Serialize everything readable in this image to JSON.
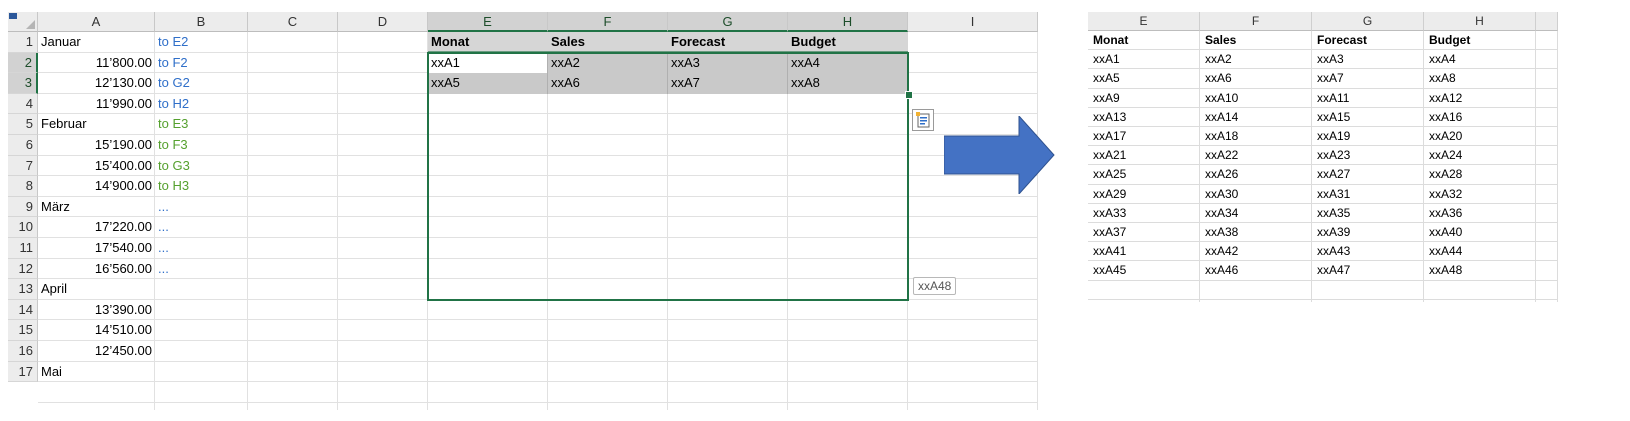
{
  "left_sheet": {
    "columns": [
      "A",
      "B",
      "C",
      "D",
      "E",
      "F",
      "G",
      "H",
      "I"
    ],
    "rows": [
      "1",
      "2",
      "3",
      "4",
      "5",
      "6",
      "7",
      "8",
      "9",
      "10",
      "11",
      "12",
      "13",
      "14",
      "15",
      "16",
      "17"
    ],
    "col_a": [
      "Januar",
      "11’800.00",
      "12’130.00",
      "11’990.00",
      "Februar",
      "15’190.00",
      "15’400.00",
      "14’900.00",
      "März",
      "17’220.00",
      "17’540.00",
      "16’560.00",
      "April",
      "13’390.00",
      "14’510.00",
      "12’450.00",
      "Mai"
    ],
    "col_b": [
      "to E2",
      "to F2",
      "to G2",
      "to H2",
      "to E3",
      "to F3",
      "to G3",
      "to H3",
      "...",
      "...",
      "...",
      "...",
      "",
      "",
      "",
      "",
      ""
    ],
    "headers": [
      "Monat",
      "Sales",
      "Forecast",
      "Budget"
    ],
    "row2": [
      "xxA1",
      "xxA2",
      "xxA3",
      "xxA4"
    ],
    "row3": [
      "xxA5",
      "xxA6",
      "xxA7",
      "xxA8"
    ],
    "autofill_tooltip": "xxA48",
    "accent_color": "#217346"
  },
  "right_sheet": {
    "columns": [
      "E",
      "F",
      "G",
      "H"
    ],
    "headers": [
      "Monat",
      "Sales",
      "Forecast",
      "Budget"
    ],
    "rows": [
      [
        "xxA1",
        "xxA2",
        "xxA3",
        "xxA4"
      ],
      [
        "xxA5",
        "xxA6",
        "xxA7",
        "xxA8"
      ],
      [
        "xxA9",
        "xxA10",
        "xxA11",
        "xxA12"
      ],
      [
        "xxA13",
        "xxA14",
        "xxA15",
        "xxA16"
      ],
      [
        "xxA17",
        "xxA18",
        "xxA19",
        "xxA20"
      ],
      [
        "xxA21",
        "xxA22",
        "xxA23",
        "xxA24"
      ],
      [
        "xxA25",
        "xxA26",
        "xxA27",
        "xxA28"
      ],
      [
        "xxA29",
        "xxA30",
        "xxA31",
        "xxA32"
      ],
      [
        "xxA33",
        "xxA34",
        "xxA35",
        "xxA36"
      ],
      [
        "xxA37",
        "xxA38",
        "xxA39",
        "xxA40"
      ],
      [
        "xxA41",
        "xxA42",
        "xxA43",
        "xxA44"
      ],
      [
        "xxA45",
        "xxA46",
        "xxA47",
        "xxA48"
      ]
    ]
  },
  "arrow_color": "#4472c4"
}
